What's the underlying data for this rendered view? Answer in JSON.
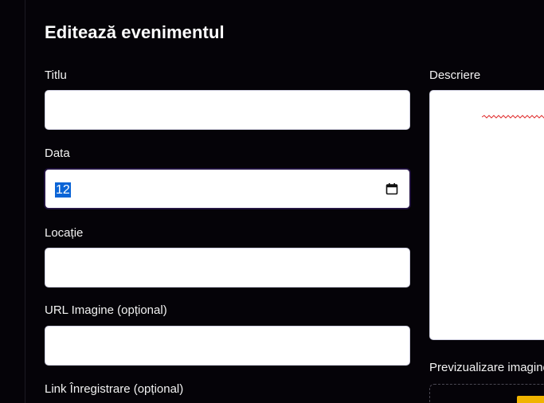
{
  "form": {
    "title": "Editează evenimentul",
    "fields": {
      "title": {
        "label": "Titlu",
        "value": ""
      },
      "date": {
        "label": "Data",
        "value": "12"
      },
      "location": {
        "label": "Locație",
        "value": ""
      },
      "image_url": {
        "label": "URL Imagine (opțional)",
        "value": ""
      },
      "registration_link": {
        "label": "Link Înregistrare (opțional)"
      },
      "description": {
        "label": "Descriere",
        "value": ""
      }
    },
    "preview": {
      "label": "Previzualizare imagine"
    }
  },
  "icons": {
    "date_picker": "calendar-icon",
    "spellcheck": "spellcheck-squiggle"
  },
  "colors": {
    "background": "#050308",
    "selection": "#0a64d6",
    "spellcheck": "#e03030",
    "preview_accent": "#f0b400"
  }
}
